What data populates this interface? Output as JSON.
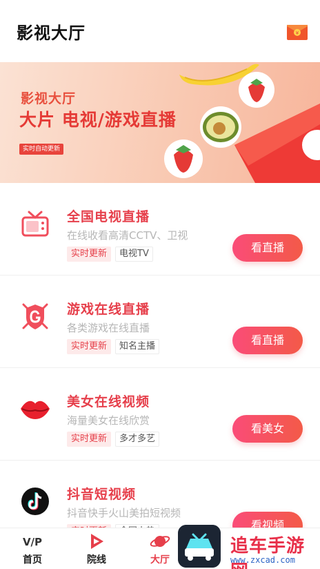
{
  "header": {
    "title": "影视大厅",
    "gift_icon": "red-envelope-icon"
  },
  "banner": {
    "subtitle": "影视大厅",
    "headline": "大片 电视/游戏直播",
    "tag": "实时自动更新",
    "colors": {
      "accent": "#e53a36",
      "background": "#f9c9b2"
    }
  },
  "cards": [
    {
      "icon": "tv-icon",
      "title": "全国电视直播",
      "desc": "在线收看高清CCTV、卫视",
      "tags": [
        "实时更新",
        "电视TV"
      ],
      "button": "看直播"
    },
    {
      "icon": "game-shield-icon",
      "title": "游戏在线直播",
      "desc": "各类游戏在线直播",
      "tags": [
        "实时更新",
        "知名主播"
      ],
      "button": "看直播"
    },
    {
      "icon": "lips-icon",
      "title": "美女在线视频",
      "desc": "海量美女在线欣赏",
      "tags": [
        "实时更新",
        "多才多艺"
      ],
      "button": "看美女"
    },
    {
      "icon": "tiktok-icon",
      "title": "抖音短视频",
      "desc": "抖音快手火山美拍短视频",
      "tags": [
        "实时更新",
        "全国上热"
      ],
      "button": "看视频"
    }
  ],
  "tabbar": {
    "tabs": [
      {
        "label": "首页",
        "icon": "vip-icon",
        "active": false
      },
      {
        "label": "院线",
        "icon": "play-icon",
        "active": false
      },
      {
        "label": "大厅",
        "icon": "planet-icon",
        "active": true
      }
    ]
  },
  "watermark": {
    "text": "追车手游网",
    "url": "www.zxcad.com"
  },
  "colors": {
    "accent": "#e63f4b",
    "button_start": "#fa4c78",
    "button_end": "#f35a48"
  }
}
